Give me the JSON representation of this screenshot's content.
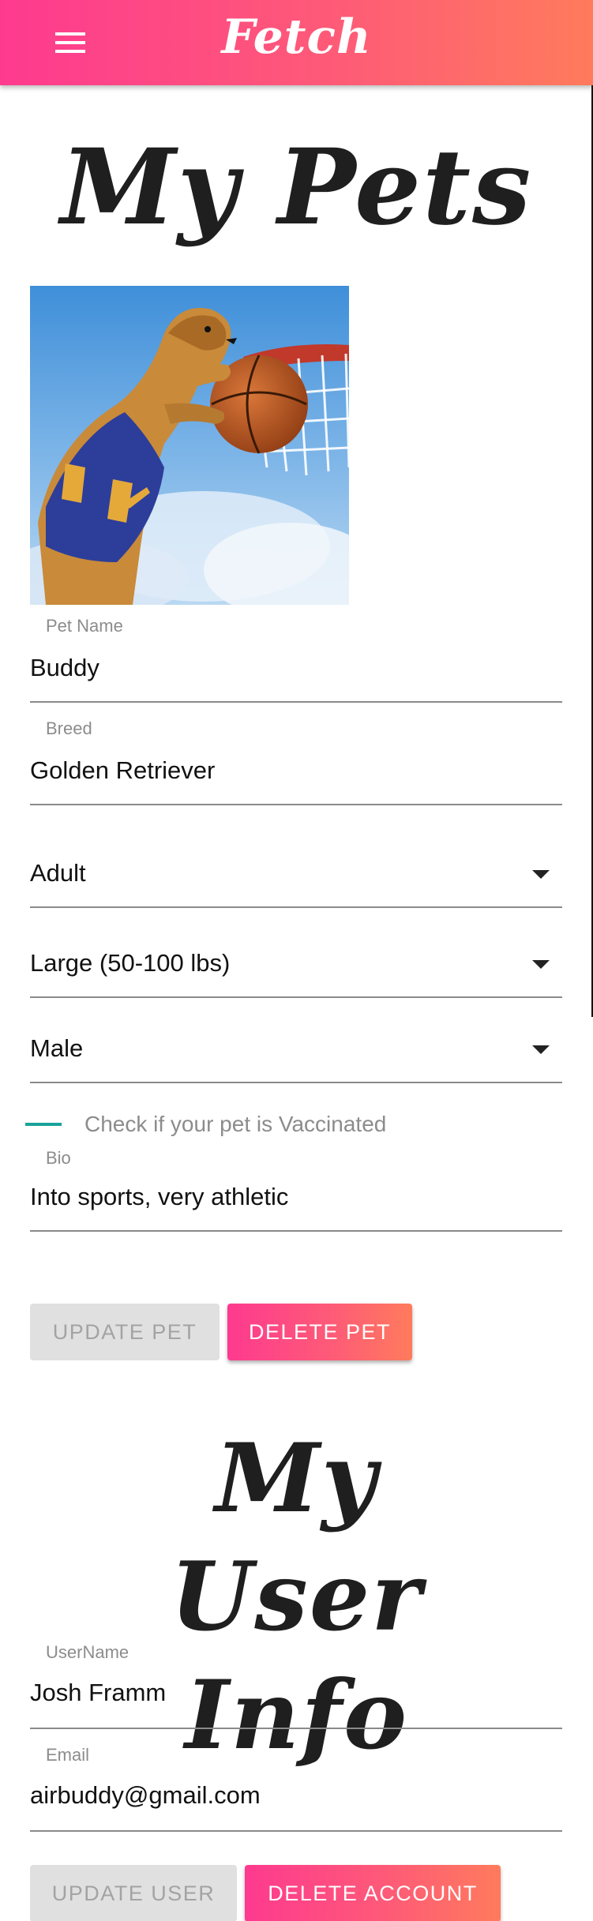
{
  "appbar": {
    "title": "Fetch",
    "menu_icon": "menu-icon"
  },
  "pets_section": {
    "heading": "My Pets",
    "pet_name": {
      "label": "Pet Name",
      "value": "Buddy"
    },
    "breed": {
      "label": "Breed",
      "value": "Golden Retriever"
    },
    "age": {
      "value": "Adult"
    },
    "size": {
      "value": "Large (50-100 lbs)"
    },
    "sex": {
      "value": "Male"
    },
    "vaccinated": {
      "label": "Check if your pet is Vaccinated"
    },
    "bio": {
      "label": "Bio",
      "value": "Into sports, very athletic"
    },
    "update_button": "UPDATE PET",
    "delete_button": "DELETE PET"
  },
  "user_section": {
    "heading": "My User Info",
    "username": {
      "label": "UserName",
      "value": "Josh Framm"
    },
    "email": {
      "label": "Email",
      "value": "airbuddy@gmail.com"
    },
    "update_button": "UPDATE USER",
    "delete_button": "DELETE ACCOUNT"
  },
  "colors": {
    "accent_start": "#fe3a8f",
    "accent_end": "#ff7b5c",
    "checkbox": "#1aa39a",
    "disabled_bg": "#e0e0e0"
  }
}
